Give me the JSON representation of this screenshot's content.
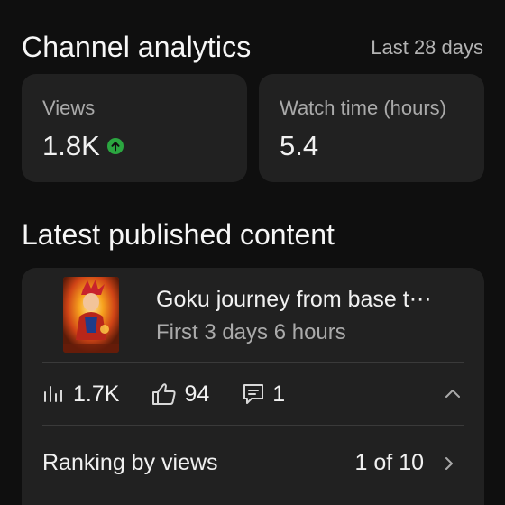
{
  "analytics": {
    "title": "Channel analytics",
    "range": "Last 28 days",
    "cards": [
      {
        "label": "Views",
        "value": "1.8K",
        "trend_icon": "arrow-up-icon",
        "trend_color": "#2ba640"
      },
      {
        "label": "Watch time (hours)",
        "value": "5.4"
      }
    ]
  },
  "latest": {
    "title": "Latest published content",
    "video": {
      "title": "Goku journey from base t⋯",
      "subtitle": "First 3 days 6 hours",
      "thumbnail_icon": "video-thumbnail"
    },
    "metrics": [
      {
        "icon": "bar-chart-icon",
        "value": "1.7K"
      },
      {
        "icon": "thumbs-up-icon",
        "value": "94"
      },
      {
        "icon": "comment-icon",
        "value": "1"
      }
    ],
    "ranking": {
      "label": "Ranking by views",
      "value": "1 of 10"
    }
  },
  "colors": {
    "background": "#0f0f0f",
    "card": "#212121",
    "accent_green": "#2ba640",
    "muted_text": "#aaaaaa"
  }
}
